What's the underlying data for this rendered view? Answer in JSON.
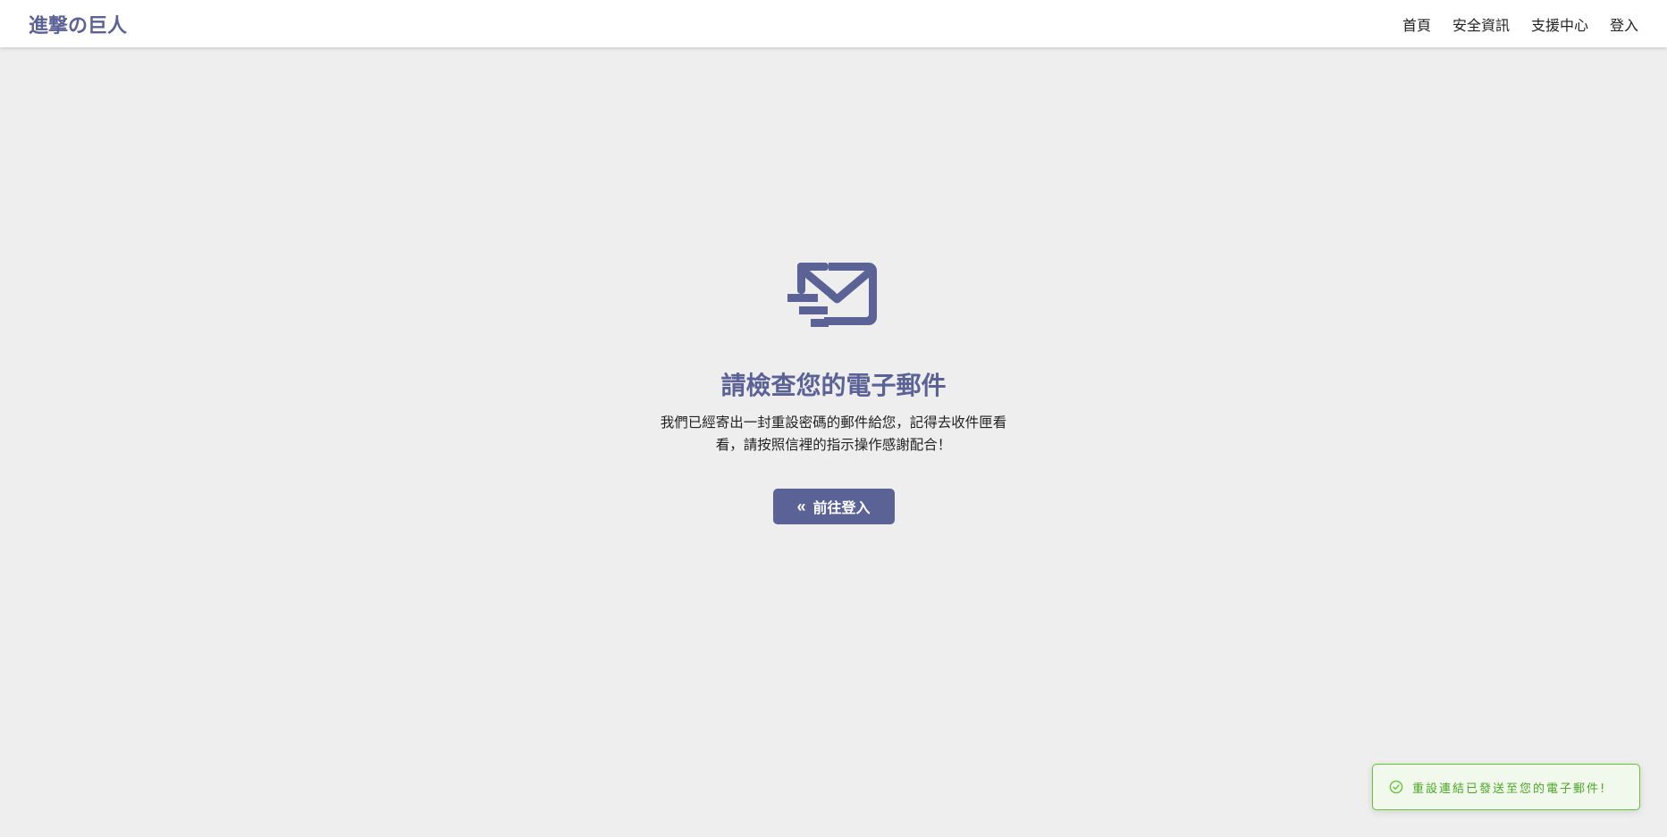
{
  "header": {
    "brand": "進撃の巨人",
    "nav": [
      "首頁",
      "安全資訊",
      "支援中心",
      "登入"
    ]
  },
  "main": {
    "icon": "mail-sending-icon",
    "title": "請檢查您的電子郵件",
    "message": "我們已經寄出一封重設密碼的郵件給您，記得去收件匣看看，請按照信裡的指示操作感謝配合！",
    "button": {
      "icon": "double-chevron-left-icon",
      "label": "前往登入"
    }
  },
  "toast": {
    "icon": "check-circle-icon",
    "text": "重設連結已發送至您的電子郵件!"
  },
  "colors": {
    "brand": "#5b6296",
    "background": "#eeeeee",
    "success": "#67c23a",
    "success_bg": "#f0f9eb"
  }
}
